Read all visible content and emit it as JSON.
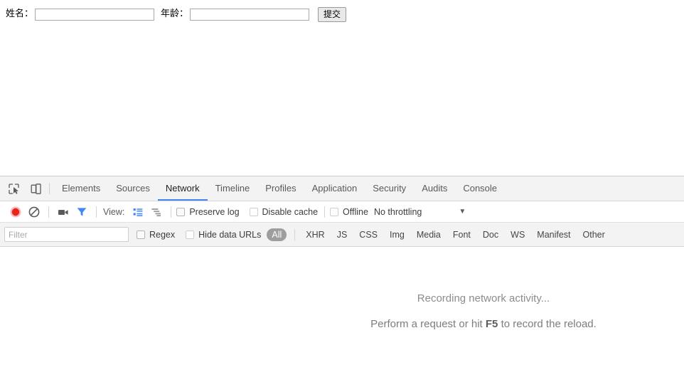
{
  "page": {
    "form": {
      "name_label": "姓名：",
      "name_value": "",
      "name_placeholder": "",
      "age_label": "年龄：",
      "age_value": "",
      "age_placeholder": "",
      "submit_label": "提交"
    }
  },
  "devtools": {
    "left_icons": [
      {
        "name": "inspect-element-icon",
        "glyph": "inspect"
      },
      {
        "name": "device-toolbar-icon",
        "glyph": "device"
      }
    ],
    "tabs": [
      {
        "label": "Elements",
        "active": false
      },
      {
        "label": "Sources",
        "active": false
      },
      {
        "label": "Network",
        "active": true
      },
      {
        "label": "Timeline",
        "active": false
      },
      {
        "label": "Profiles",
        "active": false
      },
      {
        "label": "Application",
        "active": false
      },
      {
        "label": "Security",
        "active": false
      },
      {
        "label": "Audits",
        "active": false
      },
      {
        "label": "Console",
        "active": false
      }
    ],
    "active_tab": "Network",
    "accent_color": "#4285f4",
    "record_color": "#e8241a",
    "controls": {
      "record_title": "record",
      "clear_title": "clear",
      "capture_screenshots_title": "capture-screenshots",
      "filter_title": "filter",
      "view_label": "View:",
      "view_list_title": "list-view",
      "view_waterfall_title": "waterfall-view",
      "preserve_log_label": "Preserve log",
      "preserve_log_checked": false,
      "disable_cache_label": "Disable cache",
      "disable_cache_checked": false,
      "offline_label": "Offline",
      "offline_checked": false,
      "throttling_value": "No throttling",
      "throttling_arrow": "▼"
    },
    "filterbar": {
      "filter_placeholder": "Filter",
      "filter_value": "",
      "regex_label": "Regex",
      "regex_checked": false,
      "hide_data_urls_label": "Hide data URLs",
      "hide_data_urls_checked": false,
      "types": [
        {
          "label": "All",
          "active": true
        },
        {
          "label": "XHR",
          "active": false
        },
        {
          "label": "JS",
          "active": false
        },
        {
          "label": "CSS",
          "active": false
        },
        {
          "label": "Img",
          "active": false
        },
        {
          "label": "Media",
          "active": false
        },
        {
          "label": "Font",
          "active": false
        },
        {
          "label": "Doc",
          "active": false
        },
        {
          "label": "WS",
          "active": false
        },
        {
          "label": "Manifest",
          "active": false
        },
        {
          "label": "Other",
          "active": false
        }
      ]
    },
    "empty_state": {
      "line1": "Recording network activity...",
      "line2_prefix": "Perform a request or hit ",
      "line2_key": "F5",
      "line2_suffix": " to record the reload."
    }
  }
}
